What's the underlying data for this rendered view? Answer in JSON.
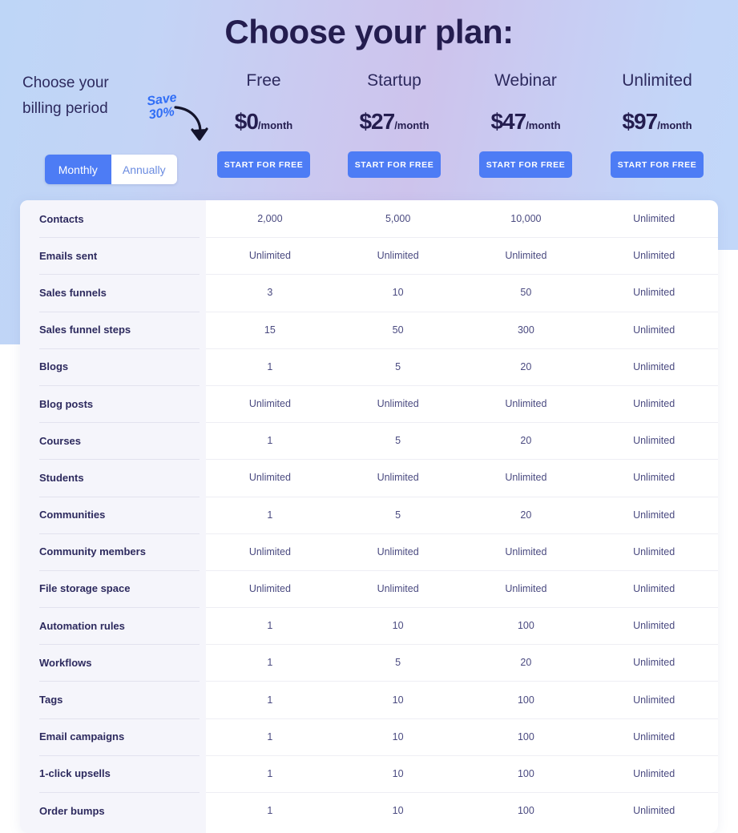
{
  "page": {
    "title": "Choose your plan:",
    "accent_blue": "#4d7cf5",
    "navy": "#2d2a5e",
    "bg_left": "#bed6f7",
    "bg_center": "#cdc3ec",
    "bg_right": "#c1d9fb"
  },
  "billing": {
    "line1": "Choose your",
    "line2": "billing period",
    "save_line1": "Save",
    "save_line2": "30%",
    "options": [
      {
        "label": "Monthly",
        "selected": true
      },
      {
        "label": "Annually",
        "selected": false
      }
    ]
  },
  "plans": [
    {
      "name": "Free",
      "price": "$0",
      "period": "/month",
      "cta": "START FOR FREE"
    },
    {
      "name": "Startup",
      "price": "$27",
      "period": "/month",
      "cta": "START FOR FREE"
    },
    {
      "name": "Webinar",
      "price": "$47",
      "period": "/month",
      "cta": "START FOR FREE"
    },
    {
      "name": "Unlimited",
      "price": "$97",
      "period": "/month",
      "cta": "START FOR FREE"
    }
  ],
  "comparison_table": {
    "columns": [
      "Free",
      "Startup",
      "Webinar",
      "Unlimited"
    ],
    "rows": [
      {
        "feature": "Contacts",
        "values": [
          "2,000",
          "5,000",
          "10,000",
          "Unlimited"
        ]
      },
      {
        "feature": "Emails sent",
        "values": [
          "Unlimited",
          "Unlimited",
          "Unlimited",
          "Unlimited"
        ]
      },
      {
        "feature": "Sales funnels",
        "values": [
          "3",
          "10",
          "50",
          "Unlimited"
        ]
      },
      {
        "feature": "Sales funnel steps",
        "values": [
          "15",
          "50",
          "300",
          "Unlimited"
        ]
      },
      {
        "feature": "Blogs",
        "values": [
          "1",
          "5",
          "20",
          "Unlimited"
        ]
      },
      {
        "feature": "Blog posts",
        "values": [
          "Unlimited",
          "Unlimited",
          "Unlimited",
          "Unlimited"
        ]
      },
      {
        "feature": "Courses",
        "values": [
          "1",
          "5",
          "20",
          "Unlimited"
        ]
      },
      {
        "feature": "Students",
        "values": [
          "Unlimited",
          "Unlimited",
          "Unlimited",
          "Unlimited"
        ]
      },
      {
        "feature": "Communities",
        "values": [
          "1",
          "5",
          "20",
          "Unlimited"
        ]
      },
      {
        "feature": "Community members",
        "values": [
          "Unlimited",
          "Unlimited",
          "Unlimited",
          "Unlimited"
        ]
      },
      {
        "feature": "File storage space",
        "values": [
          "Unlimited",
          "Unlimited",
          "Unlimited",
          "Unlimited"
        ]
      },
      {
        "feature": "Automation rules",
        "values": [
          "1",
          "10",
          "100",
          "Unlimited"
        ]
      },
      {
        "feature": "Workflows",
        "values": [
          "1",
          "5",
          "20",
          "Unlimited"
        ]
      },
      {
        "feature": "Tags",
        "values": [
          "1",
          "10",
          "100",
          "Unlimited"
        ]
      },
      {
        "feature": "Email campaigns",
        "values": [
          "1",
          "10",
          "100",
          "Unlimited"
        ]
      },
      {
        "feature": "1-click upsells",
        "values": [
          "1",
          "10",
          "100",
          "Unlimited"
        ]
      },
      {
        "feature": "Order bumps",
        "values": [
          "1",
          "10",
          "100",
          "Unlimited"
        ]
      }
    ]
  }
}
